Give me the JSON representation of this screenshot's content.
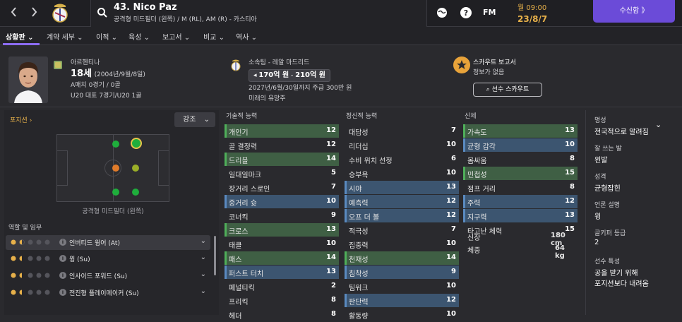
{
  "header": {
    "nav_back_icon": "chevron-left-icon",
    "nav_forward_icon": "chevron-right-icon",
    "player_name": "43. Nico Paz",
    "player_subtitle": "공격형 미드필더 (왼쪽) / M (RL), AM (R) - 카스티아",
    "fm_label": "FM",
    "day": "월 09:00",
    "date": "23/8/7",
    "continue_label": "수신함 》",
    "colors": {
      "accent": "#6b4bd8",
      "gold": "#e6b04a"
    }
  },
  "tabs": [
    {
      "label": "상황판 ⌄",
      "active": true
    },
    {
      "label": "계약 세부 ⌄"
    },
    {
      "label": "이적 ⌄"
    },
    {
      "label": "육성 ⌄"
    },
    {
      "label": "보고서 ⌄"
    },
    {
      "label": "비교 ⌄"
    },
    {
      "label": "역사 ⌄"
    }
  ],
  "profile": {
    "nationality": "아르헨티나",
    "age": "18세",
    "birth": "(2004년/9월/8일)",
    "a_caps": "A매치 0경기 / 0골",
    "u20_caps": "U20 대표 7경기/U20 1골",
    "club_label": "소속팀 - 레알 마드리드",
    "value_low": "170억 원",
    "value_sep": " - ",
    "value_high": "210억 원",
    "contract": "2027년/6월/30일까지 주급 300만 원",
    "prospect": "미래의 유망주",
    "scout_title": "스카우트 보고서",
    "scout_status": "정보가 없음",
    "scout_button": "선수 스카우트"
  },
  "positions": {
    "title": "포지션 ›",
    "emphasis_label": "강조",
    "position_label": "공격형 미드필더 (왼쪽)",
    "roles_title": "역할 및 임무",
    "roles": [
      {
        "name": "인버티드 윙어 (At)",
        "stars": 1.5,
        "selected": true
      },
      {
        "name": "윙 (Su)",
        "stars": 1.5
      },
      {
        "name": "인사이드 포워드 (Su)",
        "stars": 1.5
      },
      {
        "name": "전진형 플레이메이커 (Su)",
        "stars": 1.5
      }
    ]
  },
  "technical": {
    "title": "기술적 능력",
    "attrs": [
      {
        "name": "개인기",
        "value": "12",
        "hl": "green"
      },
      {
        "name": "골 결정력",
        "value": "12"
      },
      {
        "name": "드리블",
        "value": "14",
        "hl": "green"
      },
      {
        "name": "일대일마크",
        "value": "5"
      },
      {
        "name": "장거리 스로인",
        "value": "7"
      },
      {
        "name": "중거리 슛",
        "value": "10",
        "hl": "blue"
      },
      {
        "name": "코너킥",
        "value": "9"
      },
      {
        "name": "크로스",
        "value": "13",
        "hl": "green"
      },
      {
        "name": "태클",
        "value": "10"
      },
      {
        "name": "패스",
        "value": "14",
        "hl": "green"
      },
      {
        "name": "퍼스트 터치",
        "value": "13",
        "hl": "blue"
      },
      {
        "name": "페널티킥",
        "value": "2"
      },
      {
        "name": "프리킥",
        "value": "8"
      },
      {
        "name": "헤더",
        "value": "8"
      }
    ]
  },
  "mental": {
    "title": "정신적 능력",
    "attrs": [
      {
        "name": "대담성",
        "value": "7"
      },
      {
        "name": "리더십",
        "value": "10"
      },
      {
        "name": "수비 위치 선정",
        "value": "6"
      },
      {
        "name": "승부욕",
        "value": "10"
      },
      {
        "name": "시야",
        "value": "13",
        "hl": "blue"
      },
      {
        "name": "예측력",
        "value": "12",
        "hl": "blue"
      },
      {
        "name": "오프 더 볼",
        "value": "12",
        "hl": "blue"
      },
      {
        "name": "적극성",
        "value": "7"
      },
      {
        "name": "집중력",
        "value": "10"
      },
      {
        "name": "천재성",
        "value": "14",
        "hl": "green"
      },
      {
        "name": "침착성",
        "value": "9",
        "hl": "blue"
      },
      {
        "name": "팀워크",
        "value": "10"
      },
      {
        "name": "판단력",
        "value": "12",
        "hl": "blue"
      },
      {
        "name": "활동량",
        "value": "10"
      }
    ]
  },
  "physical": {
    "title": "신체",
    "attrs": [
      {
        "name": "가속도",
        "value": "13",
        "hl": "green"
      },
      {
        "name": "균형 감각",
        "value": "10",
        "hl": "blue"
      },
      {
        "name": "몸싸움",
        "value": "8"
      },
      {
        "name": "민첩성",
        "value": "15",
        "hl": "green"
      },
      {
        "name": "점프 거리",
        "value": "8"
      },
      {
        "name": "주력",
        "value": "12",
        "hl": "blue"
      },
      {
        "name": "지구력",
        "value": "13",
        "hl": "blue"
      },
      {
        "name": "타고난 체력",
        "value": "15"
      }
    ],
    "height_label": "신장",
    "height_value": "180 cm",
    "weight_label": "체중",
    "weight_value": "64 kg"
  },
  "info": {
    "reputation_label": "명성",
    "reputation_value": "전국적으로 알려짐",
    "foot_label": "잘 쓰는 발",
    "foot_value": "왼발",
    "personality_label": "성격",
    "personality_value": "균형잡힌",
    "media_label": "언론 설명",
    "media_value": "윙",
    "gk_label": "골키퍼 등급",
    "gk_value": "2",
    "traits_label": "선수 특성",
    "trait_1": "공을 받기 위해",
    "trait_2": "포지션보다 내려옴"
  }
}
